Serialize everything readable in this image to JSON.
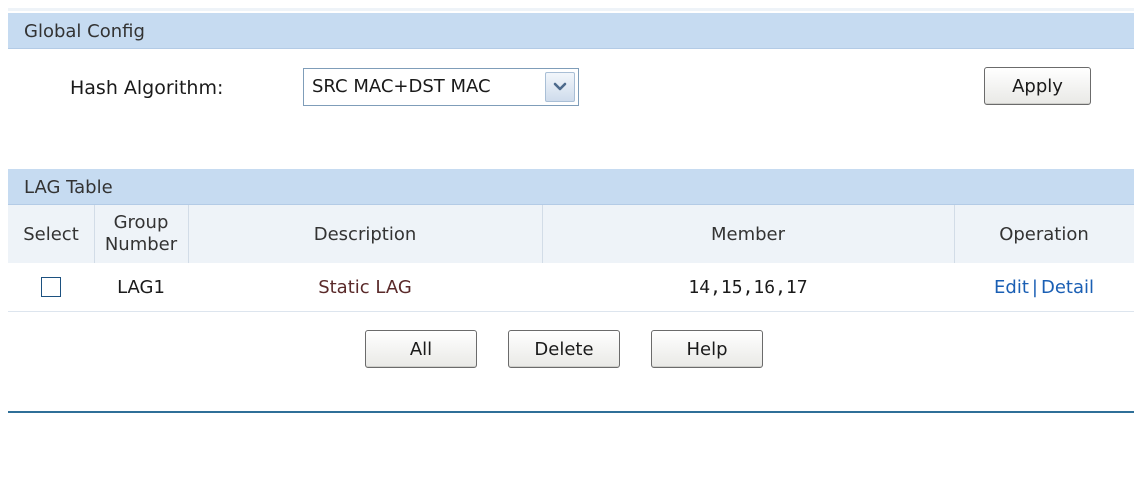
{
  "global_config": {
    "title": "Global Config",
    "hash_label": "Hash Algorithm:",
    "hash_value": "SRC MAC+DST MAC",
    "apply_label": "Apply"
  },
  "lag_table": {
    "title": "LAG Table",
    "headers": {
      "select": "Select",
      "group_number": "Group Number",
      "description": "Description",
      "member": "Member",
      "operation": "Operation"
    },
    "rows": [
      {
        "group": "LAG1",
        "description": "Static LAG",
        "member": "14,15,16,17",
        "edit": "Edit",
        "separator": "|",
        "detail": "Detail",
        "checked": false
      }
    ]
  },
  "buttons": {
    "all": "All",
    "delete": "Delete",
    "help": "Help"
  },
  "icons": {
    "dropdown": "chevron-down-icon"
  },
  "colors": {
    "header_bg": "#c6dbf1",
    "table_head_bg": "#eef3f8",
    "link": "#1a5fb4",
    "rule": "#2f6f98"
  }
}
